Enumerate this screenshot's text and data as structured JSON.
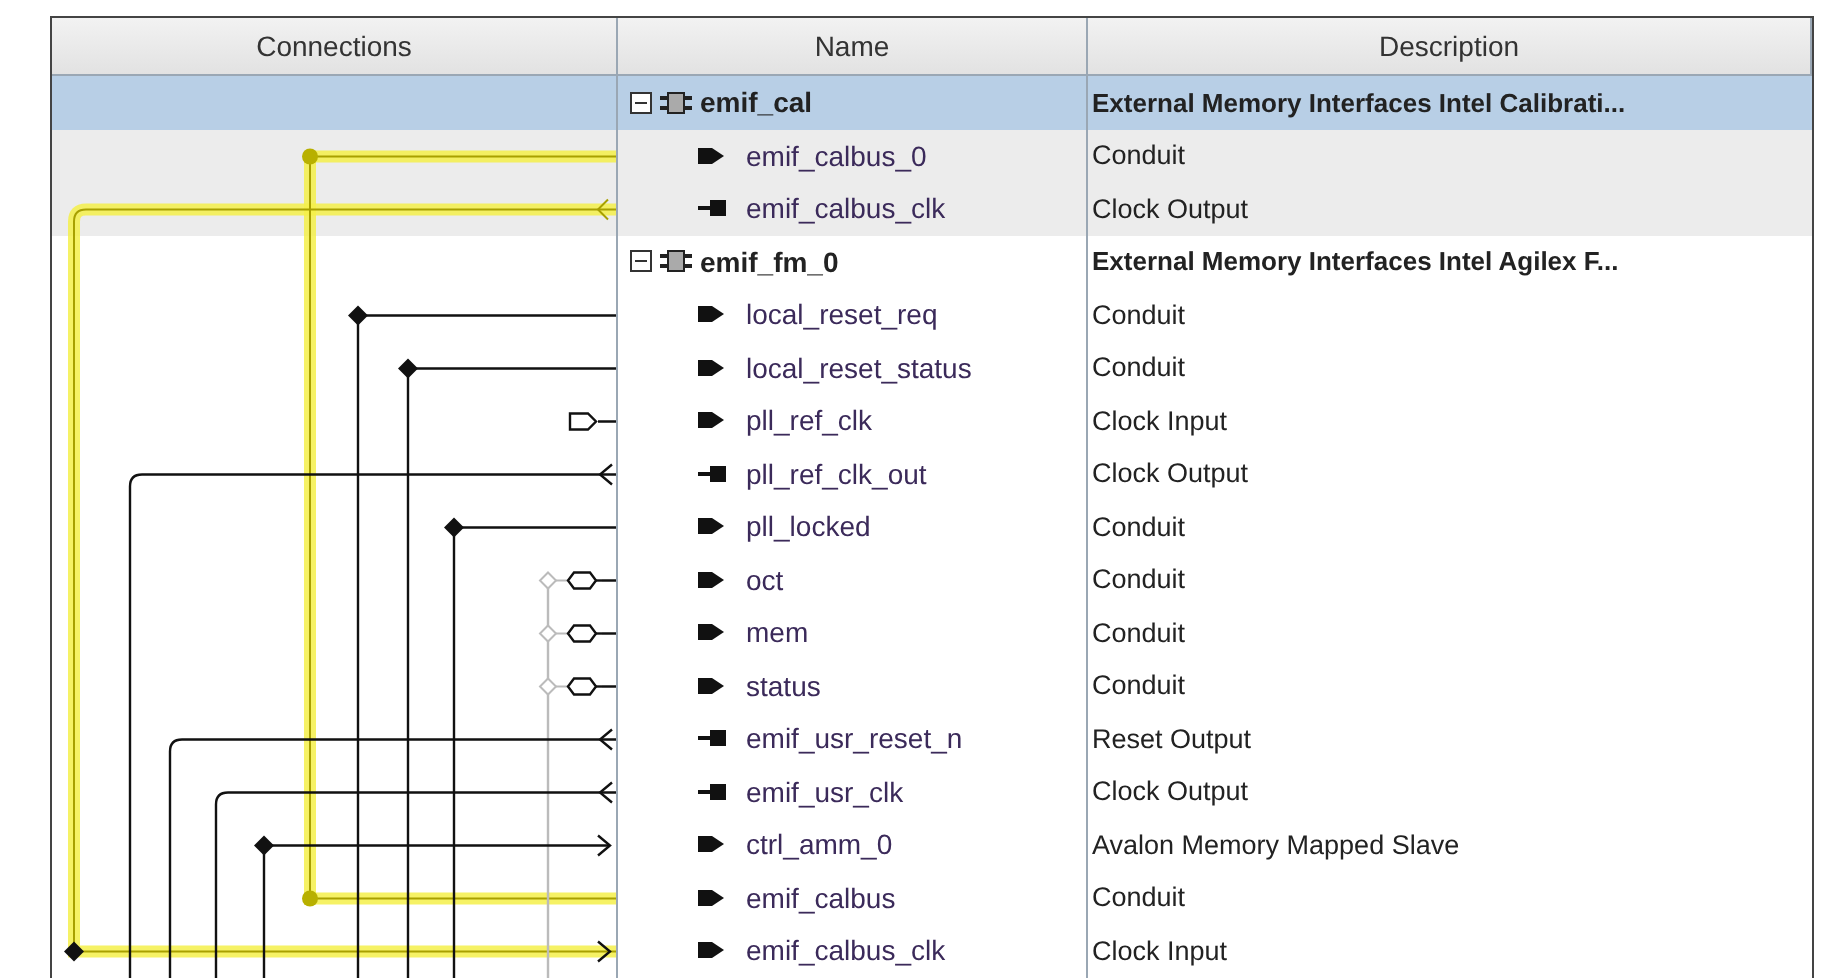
{
  "columns": [
    "Connections",
    "Name",
    "Description"
  ],
  "components": [
    {
      "name": "emif_cal",
      "description": "External Memory Interfaces Intel Calibrati...",
      "selected": true,
      "expanded": true,
      "children": [
        {
          "name": "emif_calbus_0",
          "description": "Conduit",
          "kind": "in"
        },
        {
          "name": "emif_calbus_clk",
          "description": "Clock Output",
          "kind": "out"
        }
      ]
    },
    {
      "name": "emif_fm_0",
      "description": "External Memory Interfaces Intel Agilex F...",
      "selected": false,
      "expanded": true,
      "children": [
        {
          "name": "local_reset_req",
          "description": "Conduit",
          "kind": "in"
        },
        {
          "name": "local_reset_status",
          "description": "Conduit",
          "kind": "in"
        },
        {
          "name": "pll_ref_clk",
          "description": "Clock Input",
          "kind": "in"
        },
        {
          "name": "pll_ref_clk_out",
          "description": "Clock Output",
          "kind": "out"
        },
        {
          "name": "pll_locked",
          "description": "Conduit",
          "kind": "in"
        },
        {
          "name": "oct",
          "description": "Conduit",
          "kind": "in"
        },
        {
          "name": "mem",
          "description": "Conduit",
          "kind": "in"
        },
        {
          "name": "status",
          "description": "Conduit",
          "kind": "in"
        },
        {
          "name": "emif_usr_reset_n",
          "description": "Reset Output",
          "kind": "out"
        },
        {
          "name": "emif_usr_clk",
          "description": "Clock Output",
          "kind": "out"
        },
        {
          "name": "ctrl_amm_0",
          "description": "Avalon Memory Mapped Slave",
          "kind": "in"
        },
        {
          "name": "emif_calbus",
          "description": "Conduit",
          "kind": "in"
        },
        {
          "name": "emif_calbus_clk",
          "description": "Clock Input",
          "kind": "in"
        }
      ]
    }
  ]
}
